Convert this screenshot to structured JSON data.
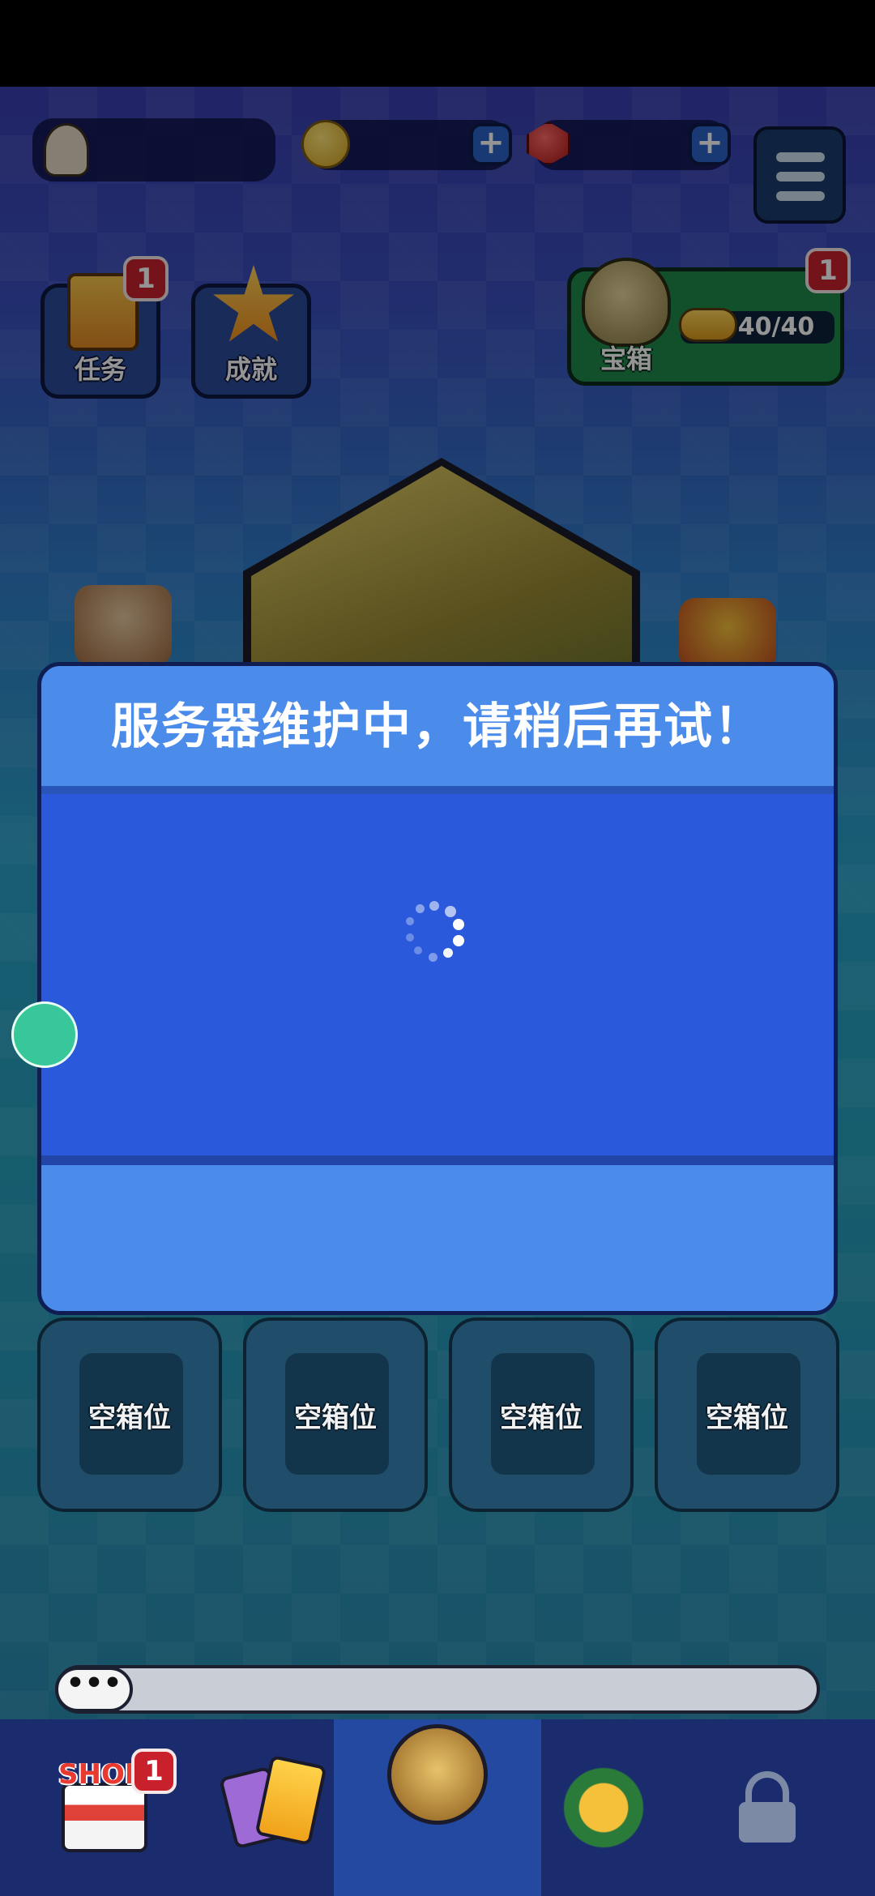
{
  "header": {
    "coin_amount": "",
    "gem_amount": ""
  },
  "shortcuts": {
    "tasks_label": "任务",
    "tasks_badge": "1",
    "achievements_label": "成就"
  },
  "chest": {
    "label": "宝箱",
    "count": "40/40",
    "badge": "1"
  },
  "dialog": {
    "title": "服务器维护中，请稍后再试！"
  },
  "chest_slots": [
    {
      "label": "空箱位"
    },
    {
      "label": "空箱位"
    },
    {
      "label": "空箱位"
    },
    {
      "label": "空箱位"
    }
  ],
  "chat": {
    "bubble_text": "•••"
  },
  "bottom_nav": {
    "shop_label": "SHOP",
    "shop_badge": "1"
  },
  "colors": {
    "dialog_header": "#4b8bea",
    "dialog_body": "#2a59dc",
    "badge_red": "#c8212c",
    "chest_green": "#1e8a4a"
  }
}
